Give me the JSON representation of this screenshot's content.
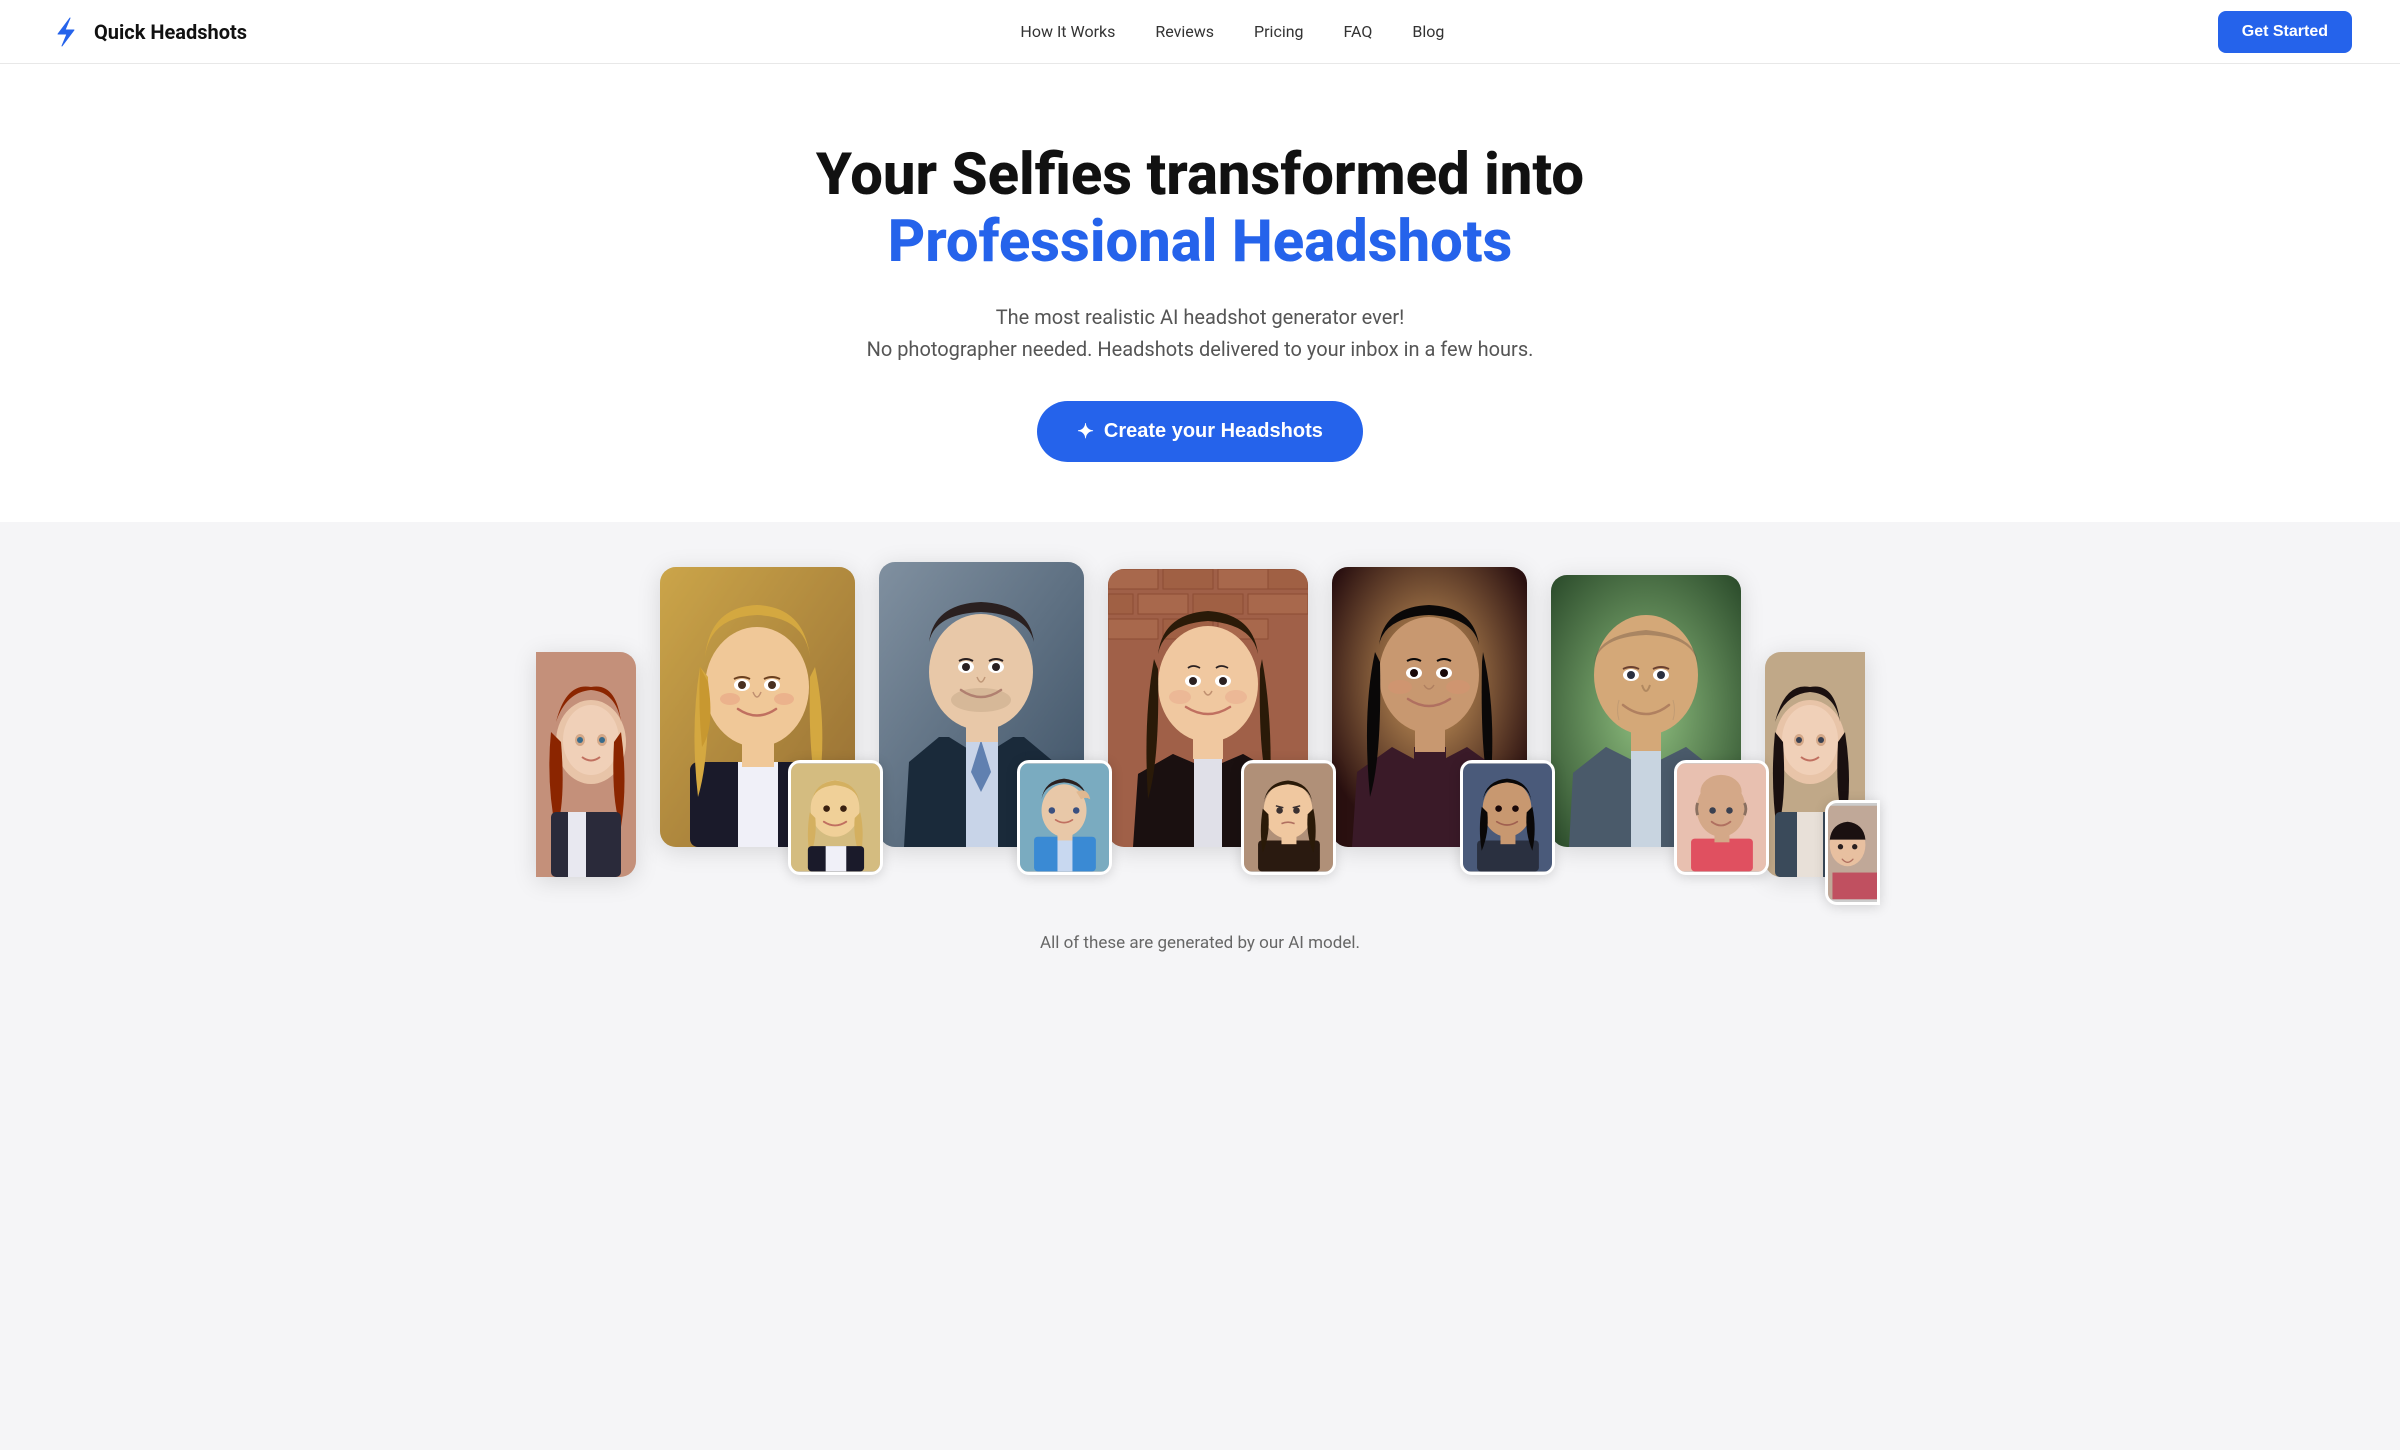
{
  "brand": {
    "name": "Quick Headshots",
    "logo_icon": "bolt"
  },
  "nav": {
    "links": [
      {
        "label": "How It Works",
        "href": "#"
      },
      {
        "label": "Reviews",
        "href": "#"
      },
      {
        "label": "Pricing",
        "href": "#"
      },
      {
        "label": "FAQ",
        "href": "#"
      },
      {
        "label": "Blog",
        "href": "#"
      }
    ],
    "cta_label": "Get Started"
  },
  "hero": {
    "title_line1": "Your Selfies transformed into",
    "title_line2": "Professional Headshots",
    "subtitle_line1": "The most realistic AI headshot generator ever!",
    "subtitle_line2": "No photographer needed. Headshots delivered to your inbox in a few hours.",
    "cta_label": "Create your Headshots"
  },
  "gallery": {
    "caption": "All of these are generated by our AI model."
  },
  "colors": {
    "accent": "#2563eb",
    "text_primary": "#111111",
    "text_secondary": "#555555"
  }
}
